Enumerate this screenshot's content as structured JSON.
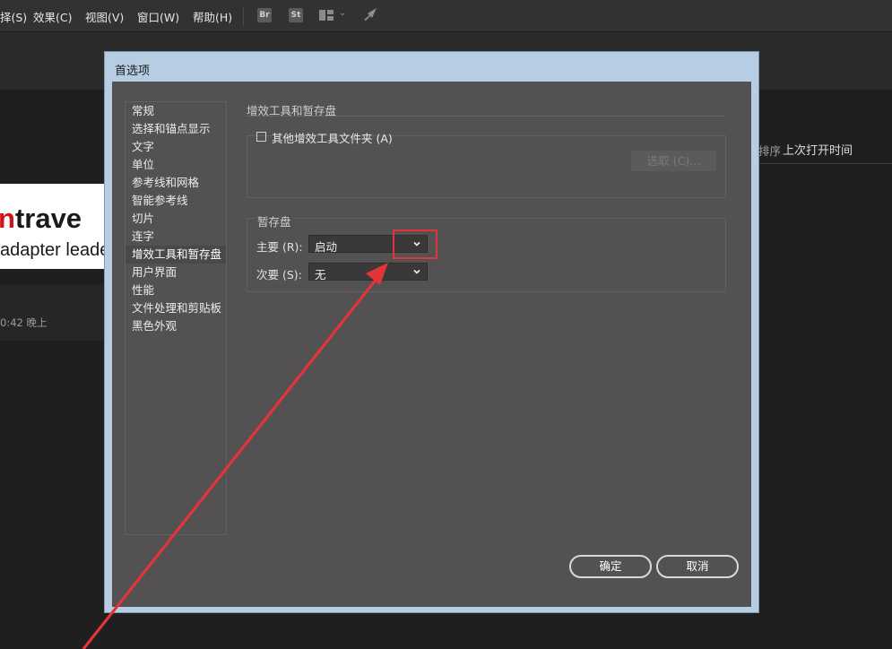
{
  "menubar": {
    "items": [
      {
        "label": "择(S)"
      },
      {
        "label": "效果(C)"
      },
      {
        "label": "视图(V)"
      },
      {
        "label": "窗口(W)"
      },
      {
        "label": "帮助(H)"
      }
    ],
    "apps": [
      {
        "label": "Br"
      },
      {
        "label": "St"
      }
    ],
    "icons": [
      "workspace-layout-icon",
      "chevron-down-icon",
      "gpu-rocket-icon"
    ]
  },
  "background": {
    "logo_part1": "n",
    "logo_part2": "trave",
    "logo_sub": "adapter leade",
    "time_text": "0:42 晚上",
    "sort_label": "排序",
    "sort_value": "上次打开时间"
  },
  "dialog": {
    "title": "首选项",
    "nav_items": [
      "常规",
      "选择和锚点显示",
      "文字",
      "单位",
      "参考线和网格",
      "智能参考线",
      "切片",
      "连字",
      "增效工具和暂存盘",
      "用户界面",
      "性能",
      "文件处理和剪贴板",
      "黑色外观"
    ],
    "selected_index": 8,
    "plugins": {
      "title": "增效工具和暂存盘",
      "checkbox_label": "其他增效工具文件夹 (A)",
      "checkbox_checked": false,
      "choose_button": "选取 (C)..."
    },
    "scratch": {
      "title": "暂存盘",
      "primary_label": "主要 (R):",
      "primary_value": "启动",
      "secondary_label": "次要 (S):",
      "secondary_value": "无"
    },
    "ok_button": "确定",
    "cancel_button": "取消"
  },
  "colors": {
    "annotation": "#e3343a",
    "dialog_frame": "#b6cde3",
    "dialog_body": "#535152"
  }
}
